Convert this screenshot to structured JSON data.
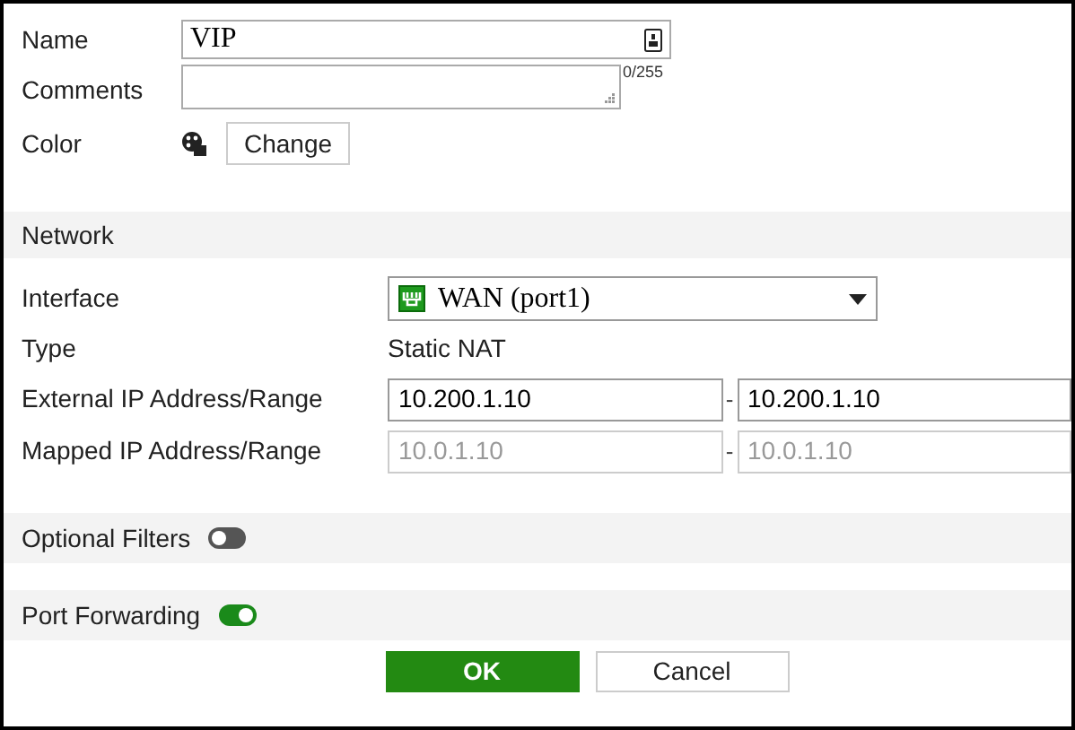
{
  "general": {
    "name": {
      "label": "Name",
      "value": "VIP"
    },
    "comments": {
      "label": "Comments",
      "counter": "0/255"
    },
    "color": {
      "label": "Color",
      "button": "Change"
    }
  },
  "network": {
    "title": "Network",
    "interface": {
      "label": "Interface",
      "value": "WAN (port1)"
    },
    "type": {
      "label": "Type",
      "value": "Static NAT"
    },
    "ranges": [
      {
        "label": "External IP Address/Range",
        "from": "10.200.1.10",
        "separator": "-",
        "to": "10.200.1.10",
        "disabled": false
      },
      {
        "label": "Mapped IP Address/Range",
        "from": "10.0.1.10",
        "separator": "-",
        "to": "10.0.1.10",
        "disabled": true
      }
    ]
  },
  "toggles": [
    {
      "label": "Optional Filters",
      "on": false
    },
    {
      "label": "Port Forwarding",
      "on": true
    }
  ],
  "buttons": [
    {
      "label": "OK",
      "kind": "primary"
    },
    {
      "label": "Cancel",
      "kind": "secondary"
    }
  ]
}
